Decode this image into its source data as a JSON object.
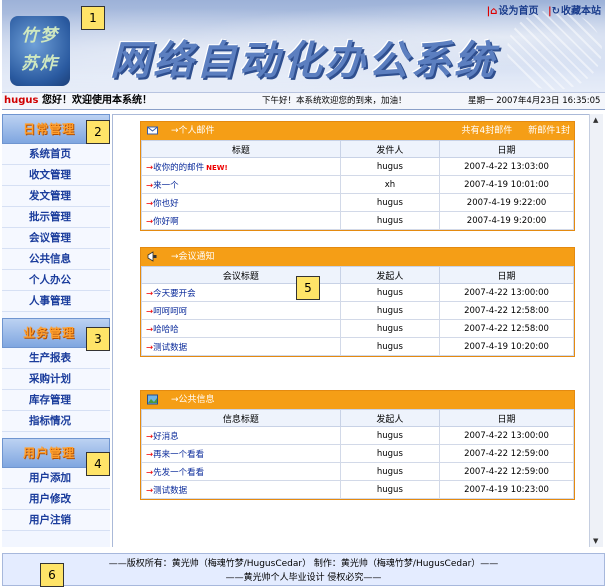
{
  "header": {
    "logo_text": "竹梦\n苏炸",
    "site_title": "网络自动化办公系统",
    "set_home": "设为首页",
    "bookmark": "收藏本站",
    "username": "hugus",
    "welcome": "您好！欢迎使用本系统！",
    "marquee": "下午好！本系统欢迎您的到来，加油！",
    "datetime": "星期一 2007年4月23日 16:35:05"
  },
  "sidebar": {
    "sections": [
      {
        "title": "日常管理",
        "items": [
          "系统首页",
          "收文管理",
          "发文管理",
          "批示管理",
          "会议管理",
          "公共信息",
          "个人办公",
          "人事管理"
        ]
      },
      {
        "title": "业务管理",
        "items": [
          "生产报表",
          "采购计划",
          "库存管理",
          "指标情况"
        ]
      },
      {
        "title": "用户管理",
        "items": [
          "用户添加",
          "用户修改",
          "用户注销"
        ]
      }
    ]
  },
  "mail": {
    "title": "→个人邮件",
    "total": "共有4封邮件",
    "new_count": "新邮件1封",
    "headers": [
      "标题",
      "发件人",
      "日期"
    ],
    "new_tag": "NEW!",
    "rows": [
      {
        "title": "收你的的邮件",
        "sender": "hugus",
        "date": "2007-4-22 13:03:00",
        "new": true
      },
      {
        "title": "来一个",
        "sender": "xh",
        "date": "2007-4-19 10:01:00",
        "new": false
      },
      {
        "title": "你也好",
        "sender": "hugus",
        "date": "2007-4-19 9:22:00",
        "new": false
      },
      {
        "title": "你好啊",
        "sender": "hugus",
        "date": "2007-4-19 9:20:00",
        "new": false
      }
    ]
  },
  "meeting": {
    "title": "→会议通知",
    "headers": [
      "会议标题",
      "发起人",
      "日期"
    ],
    "rows": [
      {
        "title": "今天要开会",
        "sender": "hugus",
        "date": "2007-4-22 13:00:00"
      },
      {
        "title": "呵呵呵呵",
        "sender": "hugus",
        "date": "2007-4-22 12:58:00"
      },
      {
        "title": "哈哈哈",
        "sender": "hugus",
        "date": "2007-4-22 12:58:00"
      },
      {
        "title": "测试数据",
        "sender": "hugus",
        "date": "2007-4-19 10:20:00"
      }
    ]
  },
  "info": {
    "title": "→公共信息",
    "headers": [
      "信息标题",
      "发起人",
      "日期"
    ],
    "rows": [
      {
        "title": "好消息",
        "sender": "hugus",
        "date": "2007-4-22 13:00:00"
      },
      {
        "title": "再来一个看看",
        "sender": "hugus",
        "date": "2007-4-22 12:59:00"
      },
      {
        "title": "先发一个看看",
        "sender": "hugus",
        "date": "2007-4-22 12:59:00"
      },
      {
        "title": "测试数据",
        "sender": "hugus",
        "date": "2007-4-19 10:23:00"
      }
    ]
  },
  "footer": {
    "line1": "——版权所有：黄光帅（梅魂竹梦/HugusCedar） 制作：黄光帅（梅魂竹梦/HugusCedar）——",
    "line2": "——黄光帅个人毕业设计 侵权必究——"
  },
  "markers": [
    "1",
    "2",
    "3",
    "4",
    "5",
    "6"
  ],
  "colors": {
    "panel_orange": "#f59e16",
    "nav_blue": "#1a3c9c",
    "title_blue": "#5c7fc0"
  }
}
